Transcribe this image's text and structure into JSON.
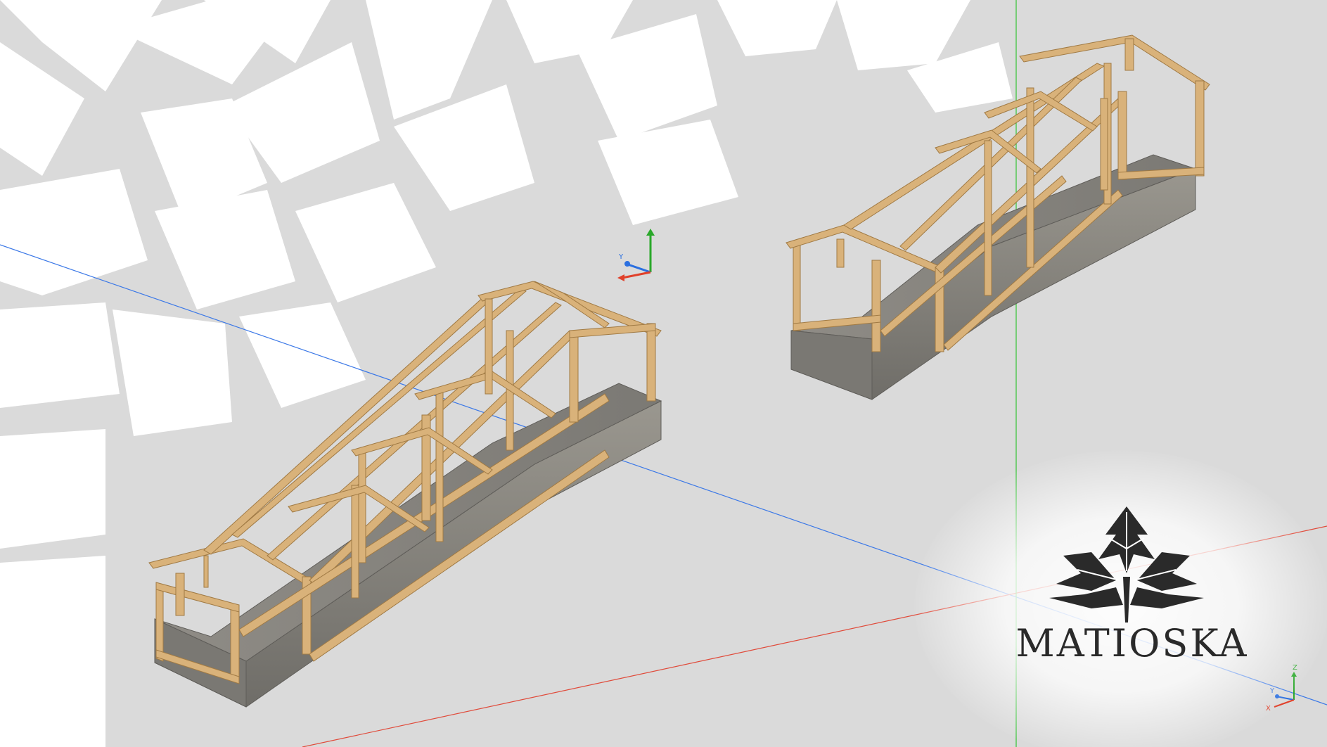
{
  "brand": {
    "name": "MATIOSKA"
  },
  "viewport": {
    "background": "#dadada",
    "axis_colors": {
      "x": "#e0402a",
      "y": "#2a6fe0",
      "z": "#2aa82a"
    },
    "gizmo_labels": {
      "x": "X",
      "y": "Y",
      "z": "Z"
    }
  },
  "model": {
    "wood_color": "#d8b27a",
    "wood_shadow": "#b98f55",
    "base_color": "#8c8a85",
    "base_shadow": "#6e6c68"
  }
}
